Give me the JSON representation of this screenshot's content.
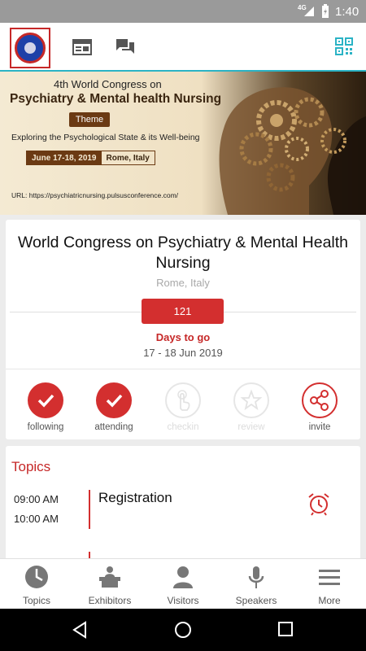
{
  "status_bar": {
    "network": "4G",
    "time": "1:40"
  },
  "app_bar": {
    "icons": [
      "event-logo",
      "browser-icon",
      "chat-icon",
      "qr-code-icon"
    ]
  },
  "banner": {
    "title_line1": "4th World Congress on",
    "title_line2": "Psychiatry & Mental health Nursing",
    "theme_label": "Theme",
    "tagline": "Exploring the Psychological State & its Well-being",
    "dates": "June 17-18, 2019",
    "place": "Rome, Italy",
    "url": "URL: https://psychiatricnursing.pulsusconference.com/"
  },
  "event": {
    "title": "World Congress on Psychiatry & Mental Health Nursing",
    "location": "Rome, Italy",
    "days_count": "121",
    "days_label": "Days to go",
    "date_range": "17 - 18 Jun 2019"
  },
  "actions": [
    {
      "label": "following",
      "icon": "check-icon",
      "active": true
    },
    {
      "label": "attending",
      "icon": "check-icon",
      "active": true
    },
    {
      "label": "checkin",
      "icon": "touch-icon",
      "active": false
    },
    {
      "label": "review",
      "icon": "star-icon",
      "active": false
    },
    {
      "label": "invite",
      "icon": "share-icon",
      "active": true
    }
  ],
  "topics": {
    "heading": "Topics",
    "items": [
      {
        "start": "09:00 AM",
        "end": "10:00 AM",
        "title": "Registration"
      }
    ]
  },
  "bottom_nav": [
    {
      "label": "Topics",
      "icon": "clock-icon"
    },
    {
      "label": "Exhibitors",
      "icon": "exhibitor-desk-icon"
    },
    {
      "label": "Visitors",
      "icon": "person-icon"
    },
    {
      "label": "Speakers",
      "icon": "microphone-icon"
    },
    {
      "label": "More",
      "icon": "menu-icon"
    }
  ],
  "colors": {
    "accent": "#d32f2f",
    "teal": "#2bb3c5"
  }
}
